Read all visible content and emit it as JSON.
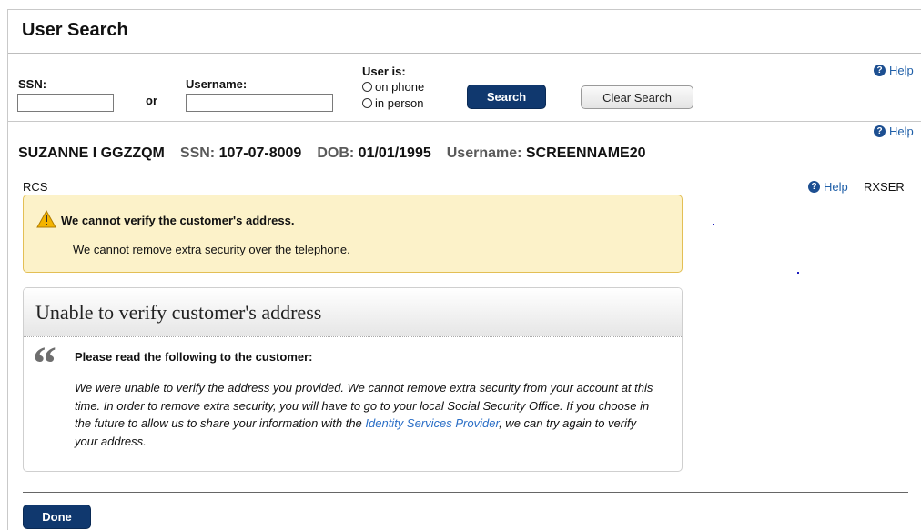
{
  "header": {
    "title": "User Search",
    "help_label": "Help"
  },
  "search": {
    "ssn_label": "SSN:",
    "or_label": "or",
    "username_label": "Username:",
    "ssn_value": "",
    "username_value": "",
    "user_is_label": "User is:",
    "radio_phone": "on phone",
    "radio_person": "in person",
    "search_button": "Search",
    "clear_button": "Clear Search"
  },
  "user": {
    "help_label": "Help",
    "name": "SUZANNE I GGZZQM",
    "ssn_key": "SSN:",
    "ssn_value": "107-07-8009",
    "dob_key": "DOB:",
    "dob_value": "01/01/1995",
    "username_key": "Username:",
    "username_value": "SCREENNAME20"
  },
  "section": {
    "left_code": "RCS",
    "help_label": "Help",
    "right_code": "RXSER"
  },
  "alert": {
    "heading": "We cannot verify the customer's address.",
    "body": "We cannot remove extra security over the telephone."
  },
  "panel": {
    "title": "Unable to verify customer's address",
    "quote_mark": "“",
    "read_heading": "Please read the following to the customer:",
    "read_body_before": "We were unable to verify the address you provided. We cannot remove extra security from your account at this time. In order to remove extra security, you will have to go to your local Social Security Office. If you choose in the future to allow us to share your information with the ",
    "read_body_link": "Identity Services Provider",
    "read_body_after": ", we can try again to verify your address."
  },
  "footer": {
    "done_button": "Done"
  },
  "colors": {
    "primary_button": "#10386e",
    "alert_bg": "#fcf2c9",
    "alert_border": "#e3bf55",
    "link": "#2a6ec6"
  }
}
